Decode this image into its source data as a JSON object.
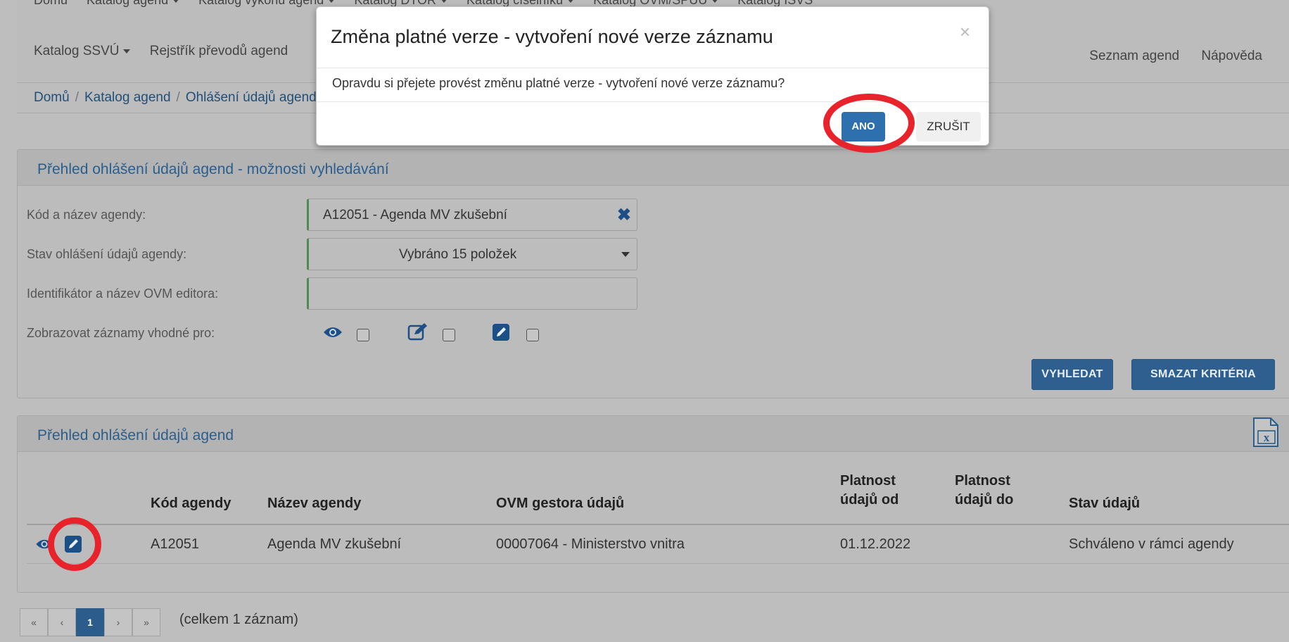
{
  "nav": {
    "row1": [
      "Domů",
      "Katalog agend",
      "Katalog výkonů agend",
      "Katalog DTOŘ",
      "Katalog číselníků",
      "Katalog OVM/SPUÚ",
      "Katalog ISVS"
    ],
    "row2": [
      "Katalog SSVÚ",
      "Rejstřík převodů agend"
    ],
    "right": [
      "Seznam agend",
      "Nápověda"
    ]
  },
  "breadcrumb": [
    "Domů",
    "Katalog agend",
    "Ohlášení údajů agend"
  ],
  "search_panel": {
    "title": "Přehled ohlášení údajů agend - možnosti vyhledávání",
    "fields": [
      {
        "label": "Kód a název agendy:",
        "value": "A12051 - Agenda MV zkušební"
      },
      {
        "label": "Stav ohlášení údajů agendy:",
        "value": "Vybráno 15 položek"
      },
      {
        "label": "Identifikátor a název OVM editora:",
        "value": ""
      },
      {
        "label": "Zobrazovat záznamy vhodné pro:",
        "value": ""
      }
    ],
    "search_button": "VYHLEDAT",
    "clear_button": "SMAZAT KRITÉRIA"
  },
  "results_panel": {
    "title": "Přehled ohlášení údajů agend",
    "columns": [
      "Kód agendy",
      "Název agendy",
      "OVM gestora údajů",
      "Platnost údajů od",
      "Platnost údajů do",
      "Stav údajů"
    ],
    "rows": [
      {
        "code": "A12051",
        "name": "Agenda MV zkušební",
        "ovm": "00007064 - Ministerstvo vnitra",
        "valid_from": "01.12.2022",
        "valid_to": "",
        "state": "Schváleno v rámci agendy"
      }
    ]
  },
  "pagination": {
    "first": "«",
    "prev": "‹",
    "current": "1",
    "next": "›",
    "last": "»",
    "summary": "(celkem 1 záznam)"
  },
  "modal": {
    "title": "Změna platné verze - vytvoření nové verze záznamu",
    "close": "×",
    "body": "Opravdu si přejete provést změnu platné verze - vytvoření nové verze záznamu?",
    "confirm": "ANO",
    "cancel": "ZRUŠIT"
  },
  "colors": {
    "accent": "#2e6fae",
    "highlight": "#e8232b",
    "overlay": "#bebebe"
  }
}
